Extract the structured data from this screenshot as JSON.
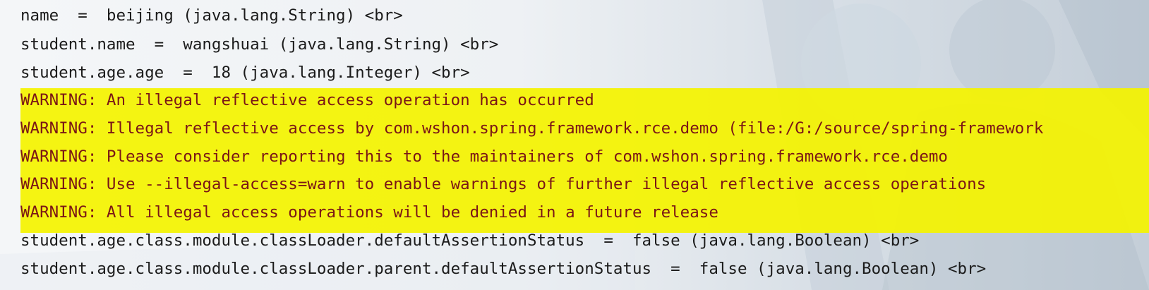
{
  "console": {
    "lines": [
      {
        "text": "name  =  beijing (java.lang.String) <br>",
        "kind": "normal"
      },
      {
        "text": "student.name  =  wangshuai (java.lang.String) <br>",
        "kind": "normal"
      },
      {
        "text": "student.age.age  =  18 (java.lang.Integer) <br>",
        "kind": "normal"
      },
      {
        "text": "WARNING: An illegal reflective access operation has occurred",
        "kind": "warning"
      },
      {
        "text": "WARNING: Illegal reflective access by com.wshon.spring.framework.rce.demo (file:/G:/source/spring-framework",
        "kind": "warning"
      },
      {
        "text": "WARNING: Please consider reporting this to the maintainers of com.wshon.spring.framework.rce.demo",
        "kind": "warning"
      },
      {
        "text": "WARNING: Use --illegal-access=warn to enable warnings of further illegal reflective access operations",
        "kind": "warning"
      },
      {
        "text": "WARNING: All illegal access operations will be denied in a future release",
        "kind": "warning"
      },
      {
        "text": "student.age.class.module.classLoader.defaultAssertionStatus  =  false (java.lang.Boolean) <br>",
        "kind": "normal"
      },
      {
        "text": "student.age.class.module.classLoader.parent.defaultAssertionStatus  =  false (java.lang.Boolean) <br>",
        "kind": "normal"
      }
    ]
  },
  "colors": {
    "warning_highlight": "#f4f300",
    "warning_text": "#7a1616",
    "normal_text": "#1b1b1b",
    "background": "#edf0f4"
  }
}
